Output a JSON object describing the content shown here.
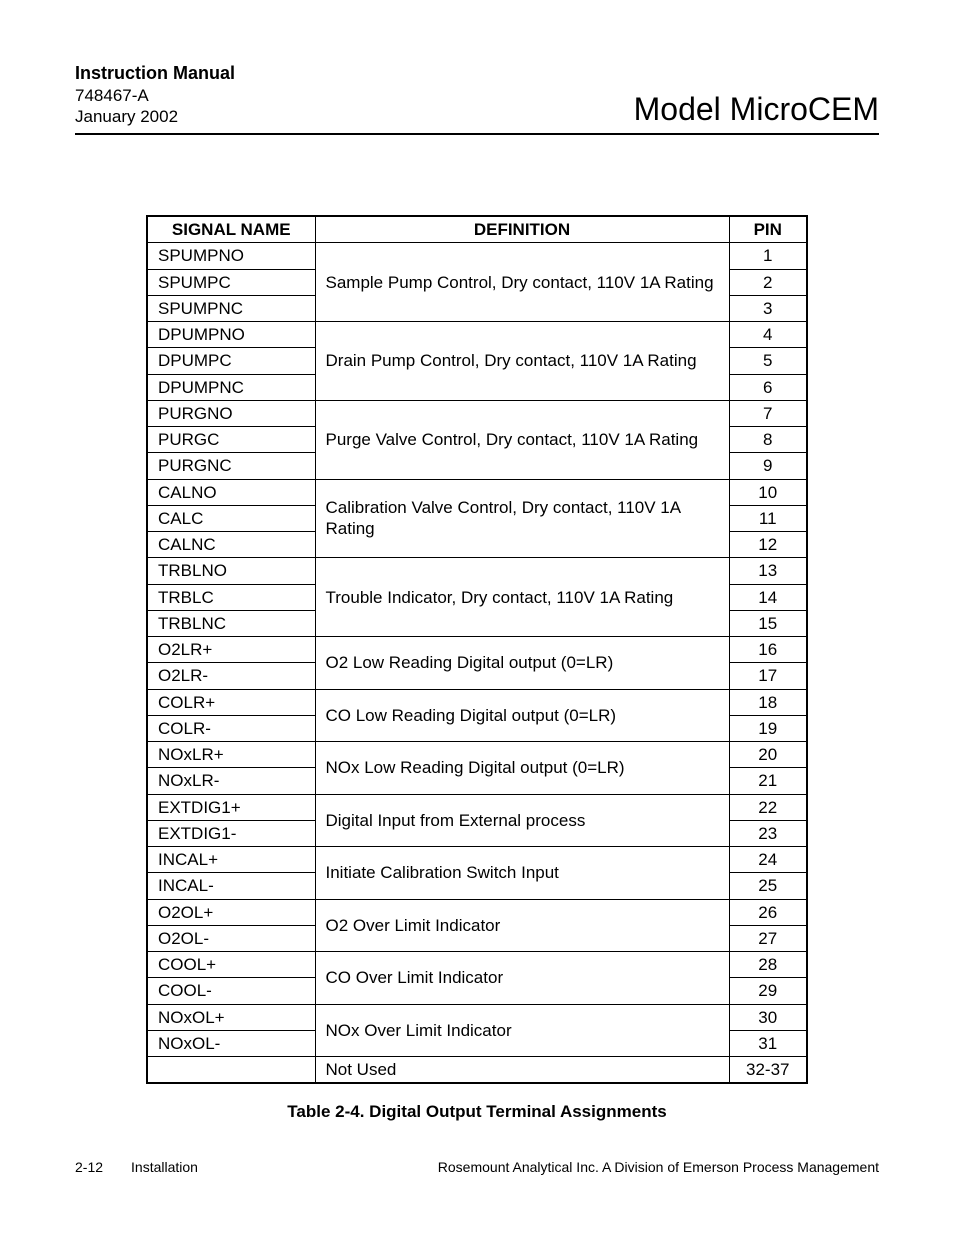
{
  "header": {
    "manual_title": "Instruction Manual",
    "doc_number": "748467-A",
    "date": "January 2002",
    "model": "Model MicroCEM"
  },
  "table": {
    "headers": {
      "signal": "SIGNAL NAME",
      "definition": "DEFINITION",
      "pin": "PIN"
    },
    "groups": [
      {
        "definition": "Sample Pump Control, Dry contact, 110V 1A Rating",
        "rows": [
          {
            "signal": "SPUMPNO",
            "pin": "1"
          },
          {
            "signal": "SPUMPC",
            "pin": "2"
          },
          {
            "signal": "SPUMPNC",
            "pin": "3"
          }
        ]
      },
      {
        "definition": "Drain Pump Control, Dry contact, 110V 1A Rating",
        "rows": [
          {
            "signal": "DPUMPNO",
            "pin": "4"
          },
          {
            "signal": "DPUMPC",
            "pin": "5"
          },
          {
            "signal": "DPUMPNC",
            "pin": "6"
          }
        ]
      },
      {
        "definition": "Purge Valve Control, Dry contact, 110V 1A Rating",
        "rows": [
          {
            "signal": "PURGNO",
            "pin": "7"
          },
          {
            "signal": "PURGC",
            "pin": "8"
          },
          {
            "signal": "PURGNC",
            "pin": "9"
          }
        ]
      },
      {
        "definition": "Calibration Valve Control, Dry contact, 110V 1A Rating",
        "rows": [
          {
            "signal": "CALNO",
            "pin": "10"
          },
          {
            "signal": "CALC",
            "pin": "11"
          },
          {
            "signal": "CALNC",
            "pin": "12"
          }
        ]
      },
      {
        "definition": "Trouble Indicator, Dry contact, 110V 1A Rating",
        "rows": [
          {
            "signal": "TRBLNO",
            "pin": "13"
          },
          {
            "signal": "TRBLC",
            "pin": "14"
          },
          {
            "signal": "TRBLNC",
            "pin": "15"
          }
        ]
      },
      {
        "definition": "O2 Low Reading Digital output (0=LR)",
        "rows": [
          {
            "signal": "O2LR+",
            "pin": "16"
          },
          {
            "signal": "O2LR-",
            "pin": "17"
          }
        ]
      },
      {
        "definition": "CO Low Reading Digital output (0=LR)",
        "rows": [
          {
            "signal": "COLR+",
            "pin": "18"
          },
          {
            "signal": "COLR-",
            "pin": "19"
          }
        ]
      },
      {
        "definition": "NOx Low Reading Digital output (0=LR)",
        "rows": [
          {
            "signal": "NOxLR+",
            "pin": "20"
          },
          {
            "signal": "NOxLR-",
            "pin": "21"
          }
        ]
      },
      {
        "definition": "Digital Input from External process",
        "rows": [
          {
            "signal": "EXTDIG1+",
            "pin": "22"
          },
          {
            "signal": "EXTDIG1-",
            "pin": "23"
          }
        ]
      },
      {
        "definition": "Initiate Calibration Switch Input",
        "rows": [
          {
            "signal": "INCAL+",
            "pin": "24"
          },
          {
            "signal": "INCAL-",
            "pin": "25"
          }
        ]
      },
      {
        "definition": "O2 Over Limit Indicator",
        "rows": [
          {
            "signal": "O2OL+",
            "pin": "26"
          },
          {
            "signal": "O2OL-",
            "pin": "27"
          }
        ]
      },
      {
        "definition": "CO Over Limit Indicator",
        "rows": [
          {
            "signal": "COOL+",
            "pin": "28"
          },
          {
            "signal": "COOL-",
            "pin": "29"
          }
        ]
      },
      {
        "definition": "NOx Over Limit Indicator",
        "rows": [
          {
            "signal": "NOxOL+",
            "pin": "30"
          },
          {
            "signal": "NOxOL-",
            "pin": "31"
          }
        ]
      },
      {
        "definition": "Not Used",
        "rows": [
          {
            "signal": "",
            "pin": "32-37"
          }
        ]
      }
    ]
  },
  "caption": "Table 2-4. Digital Output Terminal Assignments",
  "footer": {
    "page": "2-12",
    "section": "Installation",
    "company": "Rosemount Analytical Inc.    A Division of Emerson Process Management"
  }
}
